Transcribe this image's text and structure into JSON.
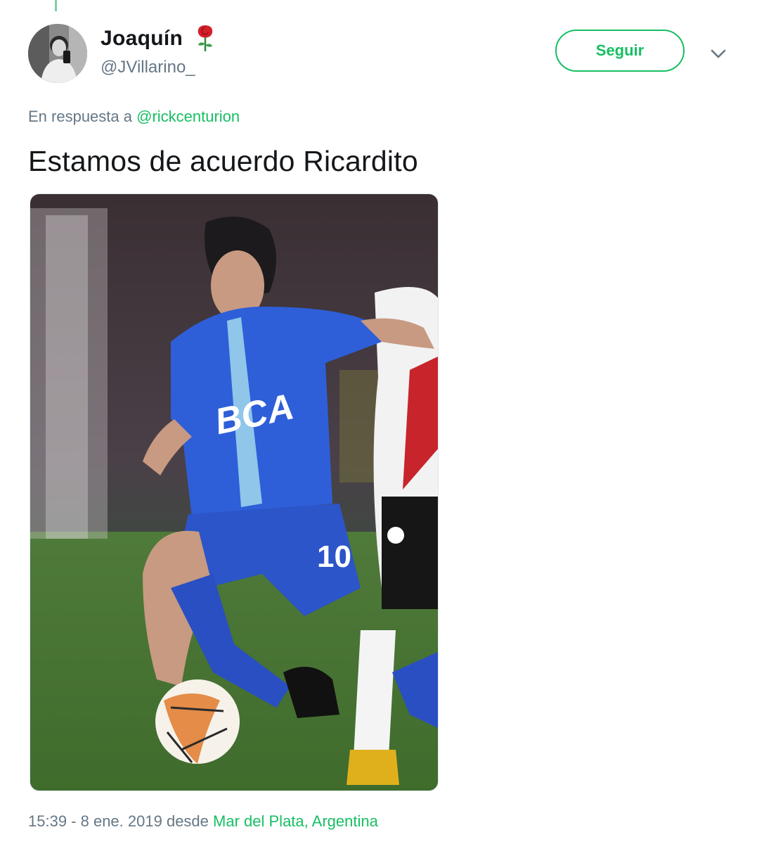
{
  "tweet": {
    "author": {
      "display_name": "Joaquín",
      "handle": "@JVillarino_",
      "name_emoji_icon": "rose-icon",
      "avatar_icon": "profile-photo"
    },
    "follow_label": "Seguir",
    "menu_icon": "chevron-down-icon",
    "reply_prefix": "En respuesta a",
    "reply_mention": "@rickcenturion",
    "text": "Estamos de acuerdo Ricardito",
    "media": {
      "kind": "photo",
      "jersey_text": "BCA",
      "jersey_number": "10"
    },
    "timestamp": "15:39 - 8 ene. 2019",
    "source_prefix": "desde",
    "location": "Mar del Plata, Argentina"
  },
  "colors": {
    "accent": "#17bf63",
    "secondary_text": "#657786",
    "primary_text": "#14171a"
  }
}
